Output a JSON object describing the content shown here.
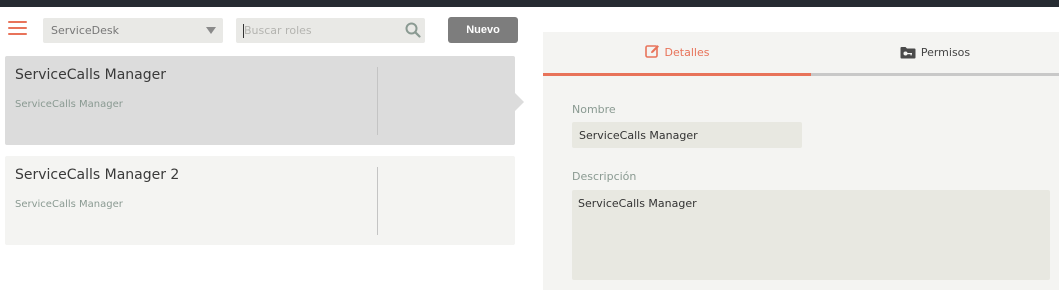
{
  "toolbar": {
    "module_select": "ServiceDesk",
    "search_placeholder": "Buscar roles",
    "search_value": "",
    "new_button": "Nuevo"
  },
  "roles": [
    {
      "name": "ServiceCalls Manager",
      "description": "ServiceCalls Manager",
      "selected": true
    },
    {
      "name": "ServiceCalls Manager 2",
      "description": "ServiceCalls Manager",
      "selected": false
    }
  ],
  "detail": {
    "tabs": [
      {
        "label": "Detalles",
        "icon": "edit-icon",
        "active": true
      },
      {
        "label": "Permisos",
        "icon": "key-folder-icon",
        "active": false
      }
    ],
    "name_label": "Nombre",
    "name_value": "ServiceCalls Manager",
    "description_label": "Descripción",
    "description_value": "ServiceCalls Manager"
  },
  "colors": {
    "accent": "#e8735a",
    "topbar": "#262b32",
    "selected_card": "#dcdcdc",
    "card": "#f4f4f2",
    "button": "#7d7d7d"
  }
}
